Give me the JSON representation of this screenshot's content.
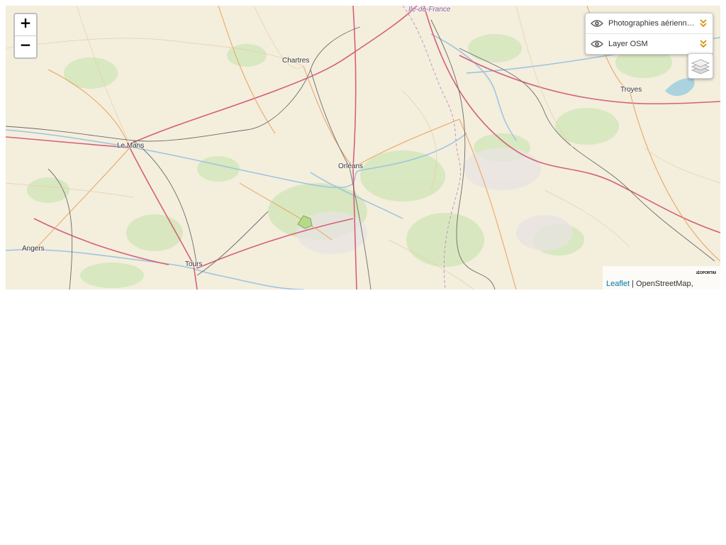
{
  "map": {
    "cities": [
      {
        "id": "chartres",
        "name": "Chartres"
      },
      {
        "id": "le-mans",
        "name": "Le Mans"
      },
      {
        "id": "orleans",
        "name": "Orléans"
      },
      {
        "id": "angers",
        "name": "Angers"
      },
      {
        "id": "tours",
        "name": "Tours"
      },
      {
        "id": "troyes",
        "name": "Troyes"
      }
    ],
    "region_label": "Île-de-France"
  },
  "zoom": {
    "in_label": "+",
    "out_label": "−"
  },
  "layers": [
    {
      "name": "Photographies aériennes",
      "icon": "eye-icon"
    },
    {
      "name": "Layer OSM",
      "icon": "eye-icon"
    }
  ],
  "layers_toggle_icon": "layers-icon",
  "attribution": {
    "leaflet_label": "Leaflet",
    "separator": " | ",
    "osm_label": "OpenStreetMap,",
    "logo_text": "GÉOPORTAIL"
  },
  "colors": {
    "map_background": "#f2efe9",
    "link": "#0078a8",
    "chevron": "#d68a00"
  }
}
